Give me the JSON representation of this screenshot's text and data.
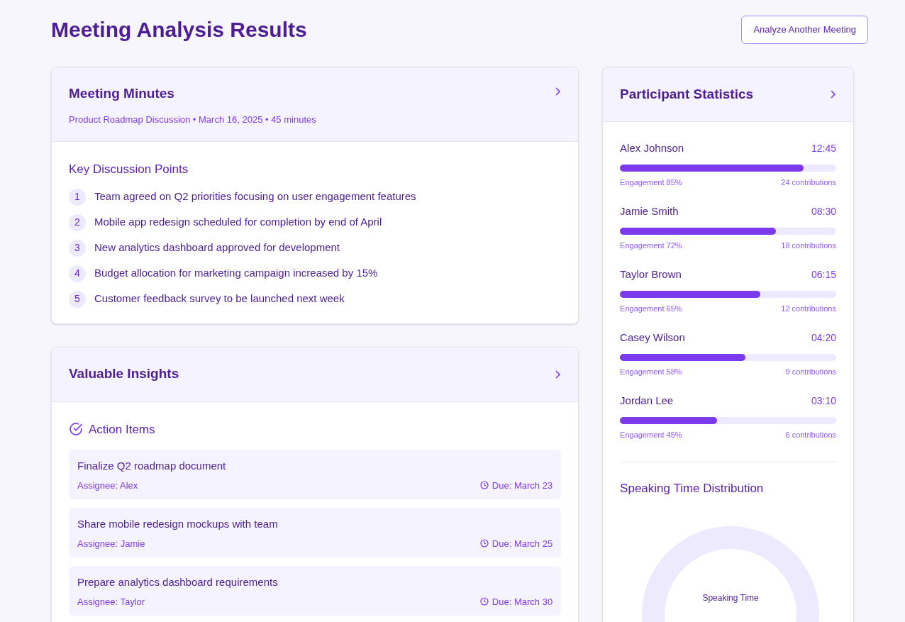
{
  "page": {
    "title": "Meeting Analysis Results",
    "action_button": "Analyze Another Meeting"
  },
  "minutes": {
    "title": "Meeting Minutes",
    "subtitle": "Product Roadmap Discussion • March 16, 2025 • 45 minutes",
    "section_title": "Key Discussion Points",
    "points": [
      {
        "number": "1",
        "text": "Team agreed on Q2 priorities focusing on user engagement features"
      },
      {
        "number": "2",
        "text": "Mobile app redesign scheduled for completion by end of April"
      },
      {
        "number": "3",
        "text": "New analytics dashboard approved for development"
      },
      {
        "number": "4",
        "text": "Budget allocation for marketing campaign increased by 15%"
      },
      {
        "number": "5",
        "text": "Customer feedback survey to be launched next week"
      }
    ]
  },
  "insights": {
    "title": "Valuable Insights",
    "section_title": "Action Items",
    "action_items": [
      {
        "title": "Finalize Q2 roadmap document",
        "assignee": "Assignee: Alex",
        "due": "Due: March 23"
      },
      {
        "title": "Share mobile redesign mockups with team",
        "assignee": "Assignee: Jamie",
        "due": "Due: March 25"
      },
      {
        "title": "Prepare analytics dashboard requirements",
        "assignee": "Assignee: Taylor",
        "due": "Due: March 30"
      }
    ]
  },
  "participants": {
    "title": "Participant Statistics",
    "people": [
      {
        "name": "Alex Johnson",
        "time": "12:45",
        "level": 0.85,
        "engagement": "Engagement 85%",
        "contributions": "24 contributions"
      },
      {
        "name": "Jamie Smith",
        "time": "08:30",
        "level": 0.72,
        "engagement": "Engagement 72%",
        "contributions": "18 contributions"
      },
      {
        "name": "Taylor Brown",
        "time": "06:15",
        "level": 0.65,
        "engagement": "Engagement 65%",
        "contributions": "12 contributions"
      },
      {
        "name": "Casey Wilson",
        "time": "04:20",
        "level": 0.58,
        "engagement": "Engagement 58%",
        "contributions": "9 contributions"
      },
      {
        "name": "Jordan Lee",
        "time": "03:10",
        "level": 0.45,
        "engagement": "Engagement 45%",
        "contributions": "6 contributions"
      }
    ],
    "distribution_title": "Speaking Time Distribution",
    "donut_label": "Speaking Time"
  }
}
